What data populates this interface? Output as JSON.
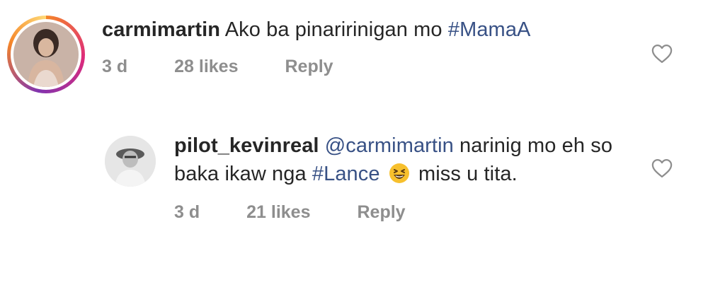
{
  "comments": [
    {
      "username": "carmimartin",
      "text": "Ako ba pinaririnigan mo",
      "hashtag": "#MamaA",
      "time": "3 d",
      "likes": "28 likes",
      "reply": "Reply"
    },
    {
      "username": "pilot_kevinreal",
      "mention": "@carmimartin",
      "text_part1": "narinig mo eh so baka ikaw nga",
      "hashtag": "#Lance",
      "text_part2": "miss u tita.",
      "emoji": "grinning-squinting-face",
      "time": "3 d",
      "likes": "21 likes",
      "reply": "Reply"
    }
  ],
  "colors": {
    "link": "#385185",
    "meta": "#8e8e8e",
    "text": "#262626"
  }
}
